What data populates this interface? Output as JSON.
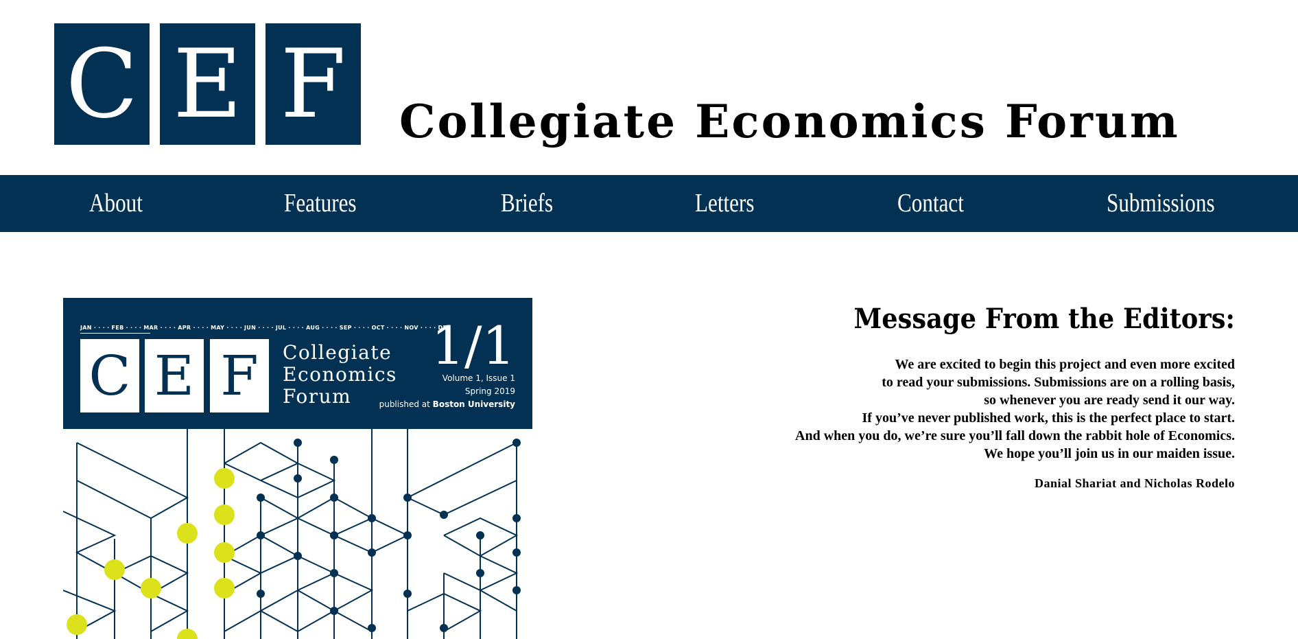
{
  "header": {
    "logo_letters": [
      "C",
      "E",
      "F"
    ],
    "site_title": "Collegiate Economics Forum"
  },
  "nav": {
    "items": [
      {
        "label": "About"
      },
      {
        "label": "Features"
      },
      {
        "label": "Briefs"
      },
      {
        "label": "Letters"
      },
      {
        "label": "Contact"
      },
      {
        "label": "Submissions"
      }
    ]
  },
  "cover": {
    "months": "JAN · · · · FEB · · · · MAR · · · · APR · · · · MAY · · · · JUN · · · · JUL · · · · AUG · · · · SEP · · · · OCT · · · · NOV · · · · DEC",
    "logo_letters": [
      "C",
      "E",
      "F"
    ],
    "title_lines": [
      "Collegiate",
      "Economics",
      "Forum"
    ],
    "issue_number": "1/1",
    "volume": "Volume 1, Issue 1",
    "season": "Spring 2019",
    "published_prefix": "published at",
    "published_place": "Boston University"
  },
  "message": {
    "heading": "Message From the Editors:",
    "lines": [
      "We are excited to begin this project and even more excited",
      "to read your submissions. Submissions are on a rolling basis,",
      "so whenever you are ready send it our way.",
      "If you’ve never published work, this is the perfect place to start.",
      "And when you do, we’re sure you’ll fall down the rabbit hole of Economics.",
      "We hope you’ll join us in our maiden issue."
    ],
    "signature": "Danial Shariat and Nicholas Rodelo"
  },
  "colors": {
    "brand_navy": "#033153",
    "accent_yellow": "#dbe21c",
    "background": "#ffffff",
    "text": "#000000"
  }
}
